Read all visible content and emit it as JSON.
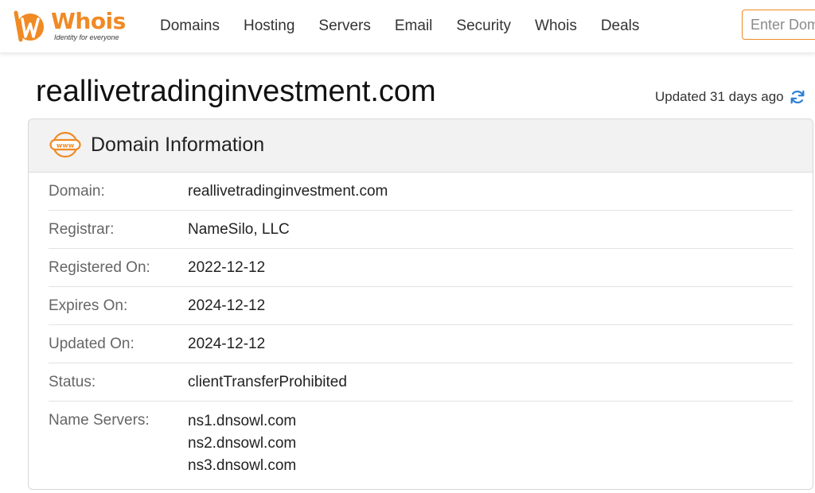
{
  "brand": {
    "name": "Whois",
    "tagline": "Identity for everyone",
    "color": "#f08a24"
  },
  "nav": {
    "items": [
      {
        "label": "Domains"
      },
      {
        "label": "Hosting"
      },
      {
        "label": "Servers"
      },
      {
        "label": "Email"
      },
      {
        "label": "Security"
      },
      {
        "label": "Whois"
      },
      {
        "label": "Deals"
      }
    ]
  },
  "search": {
    "placeholder": "Enter Domain"
  },
  "page": {
    "title": "reallivetradinginvestment.com",
    "updated": "Updated 31 days ago",
    "refresh_icon": "refresh-icon"
  },
  "card": {
    "icon": "www-icon",
    "title": "Domain Information",
    "rows": [
      {
        "label": "Domain:",
        "value": "reallivetradinginvestment.com"
      },
      {
        "label": "Registrar:",
        "value": "NameSilo, LLC"
      },
      {
        "label": "Registered On:",
        "value": "2022-12-12"
      },
      {
        "label": "Expires On:",
        "value": "2024-12-12"
      },
      {
        "label": "Updated On:",
        "value": "2024-12-12"
      },
      {
        "label": "Status:",
        "value": "clientTransferProhibited"
      }
    ],
    "name_servers": {
      "label": "Name Servers:",
      "values": [
        "ns1.dnsowl.com",
        "ns2.dnsowl.com",
        "ns3.dnsowl.com"
      ]
    }
  }
}
